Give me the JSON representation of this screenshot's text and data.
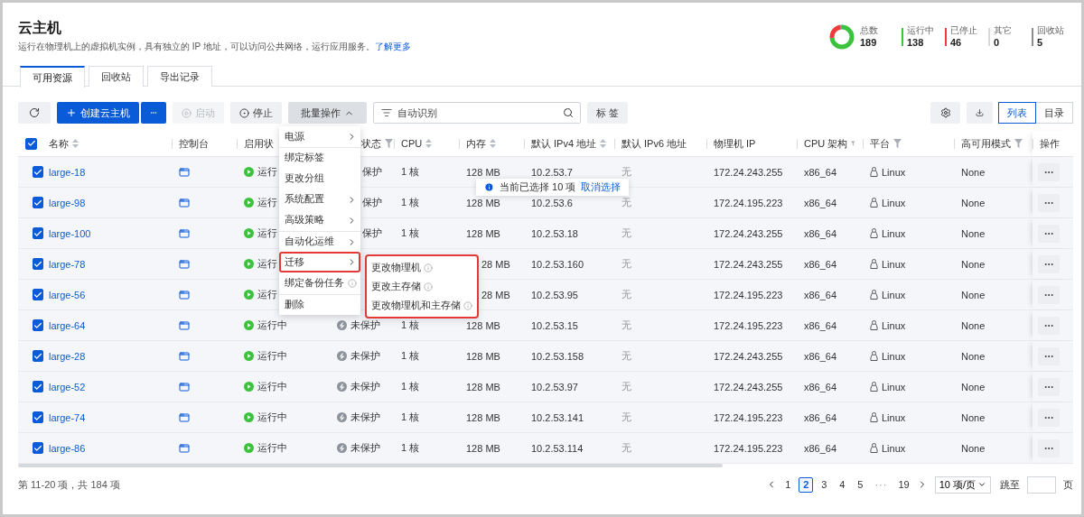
{
  "page": {
    "title": "云主机",
    "description": "运行在物理机上的虚拟机实例，具有独立的 IP 地址，可以访问公共网络，运行应用服务。",
    "learn_more": "了解更多"
  },
  "stats": [
    {
      "kind": "total",
      "label": "总数",
      "value": "189"
    },
    {
      "kind": "part",
      "label": "运行中",
      "value": "138",
      "color": "#3cc23c"
    },
    {
      "kind": "part",
      "label": "已停止",
      "value": "46",
      "color": "#ee3b3b"
    },
    {
      "kind": "part",
      "label": "其它",
      "value": "0",
      "color": "#d9d9d9"
    },
    {
      "kind": "part",
      "label": "回收站",
      "value": "5",
      "color": "#8c8c8c"
    }
  ],
  "tabs": [
    {
      "label": "可用资源",
      "selected": true
    },
    {
      "label": "回收站",
      "selected": false
    },
    {
      "label": "导出记录",
      "selected": false
    }
  ],
  "toolbar": {
    "create": "创建云主机",
    "start": {
      "label": "启动",
      "disabled": true
    },
    "stop": {
      "label": "停止",
      "disabled": false
    },
    "batch": {
      "label": "批量操作",
      "open": true
    },
    "search": {
      "placeholder": "自动识别"
    },
    "tags": "标 签",
    "views": [
      {
        "label": "列表",
        "selected": true
      },
      {
        "label": "目录",
        "selected": false
      }
    ]
  },
  "table": {
    "all_checked": true,
    "columns": [
      {
        "label": "名称",
        "kind": "sortable"
      },
      {
        "label": "控制台",
        "kind": "plain"
      },
      {
        "label": "启用状",
        "kind": "plain"
      },
      {
        "label": "状态",
        "kind": "filterable"
      },
      {
        "label": "CPU",
        "kind": "sortable"
      },
      {
        "label": "内存",
        "kind": "sortable"
      },
      {
        "label": "默认 IPv4 地址",
        "kind": "sortable"
      },
      {
        "label": "默认 IPv6 地址",
        "kind": "plain"
      },
      {
        "label": "物理机 IP",
        "kind": "plain"
      },
      {
        "label": "CPU 架构",
        "kind": "filterable"
      },
      {
        "label": "平台",
        "kind": "filterable"
      },
      {
        "label": "高可用模式",
        "kind": "filterable"
      },
      {
        "label": "操作",
        "kind": "plain"
      }
    ],
    "rows": [
      {
        "checked": true,
        "name": "large-18",
        "status": "运行",
        "protection": "保护",
        "cpu": "1 核",
        "memory": "128 MB",
        "ipv4": "10.2.53.7",
        "ipv6": "无",
        "host_ip": "172.24.243.255",
        "arch": "x86_64",
        "platform": "Linux",
        "ha": "None"
      },
      {
        "checked": true,
        "name": "large-98",
        "status": "运行",
        "protection": "保护",
        "cpu": "1 核",
        "memory": "128 MB",
        "ipv4": "10.2.53.6",
        "ipv6": "无",
        "host_ip": "172.24.195.223",
        "arch": "x86_64",
        "platform": "Linux",
        "ha": "None"
      },
      {
        "checked": true,
        "name": "large-100",
        "status": "运行",
        "protection": "保护",
        "cpu": "1 核",
        "memory": "128 MB",
        "ipv4": "10.2.53.18",
        "ipv6": "无",
        "host_ip": "172.24.243.255",
        "arch": "x86_64",
        "platform": "Linux",
        "ha": "None"
      },
      {
        "checked": true,
        "name": "large-78",
        "status": "运行",
        "memory": "28 MB",
        "ipv4": "10.2.53.160",
        "ipv6": "无",
        "host_ip": "172.24.243.255",
        "arch": "x86_64",
        "platform": "Linux",
        "ha": "None"
      },
      {
        "checked": true,
        "name": "large-56",
        "status": "运行",
        "memory": "28 MB",
        "ipv4": "10.2.53.95",
        "ipv6": "无",
        "host_ip": "172.24.195.223",
        "arch": "x86_64",
        "platform": "Linux",
        "ha": "None"
      },
      {
        "checked": true,
        "name": "large-64",
        "status": "运行中",
        "protection": "未保护",
        "cpu": "1 核",
        "memory": "128 MB",
        "ipv4": "10.2.53.15",
        "ipv6": "无",
        "host_ip": "172.24.195.223",
        "arch": "x86_64",
        "platform": "Linux",
        "ha": "None"
      },
      {
        "checked": true,
        "name": "large-28",
        "status": "运行中",
        "protection": "未保护",
        "cpu": "1 核",
        "memory": "128 MB",
        "ipv4": "10.2.53.158",
        "ipv6": "无",
        "host_ip": "172.24.243.255",
        "arch": "x86_64",
        "platform": "Linux",
        "ha": "None"
      },
      {
        "checked": true,
        "name": "large-52",
        "status": "运行中",
        "protection": "未保护",
        "cpu": "1 核",
        "memory": "128 MB",
        "ipv4": "10.2.53.97",
        "ipv6": "无",
        "host_ip": "172.24.243.255",
        "arch": "x86_64",
        "platform": "Linux",
        "ha": "None"
      },
      {
        "checked": true,
        "name": "large-74",
        "status": "运行中",
        "protection": "未保护",
        "cpu": "1 核",
        "memory": "128 MB",
        "ipv4": "10.2.53.141",
        "ipv6": "无",
        "host_ip": "172.24.195.223",
        "arch": "x86_64",
        "platform": "Linux",
        "ha": "None"
      },
      {
        "checked": true,
        "name": "large-86",
        "status": "运行中",
        "protection": "未保护",
        "cpu": "1 核",
        "memory": "128 MB",
        "ipv4": "10.2.53.114",
        "ipv6": "无",
        "host_ip": "172.24.195.223",
        "arch": "x86_64",
        "platform": "Linux",
        "ha": "None"
      }
    ],
    "selection_tip": {
      "text": "当前已选择 10 项",
      "action": "取消选择"
    }
  },
  "batch_menu": [
    {
      "label": "电源",
      "kind": "submenu",
      "divider": false,
      "highlighted": false
    },
    {
      "label": "绑定标签",
      "kind": "action",
      "divider": true,
      "highlighted": false
    },
    {
      "label": "更改分组",
      "kind": "action",
      "divider": false,
      "highlighted": false
    },
    {
      "label": "系统配置",
      "kind": "submenu",
      "divider": false,
      "highlighted": false
    },
    {
      "label": "高级策略",
      "kind": "submenu",
      "divider": false,
      "highlighted": false
    },
    {
      "label": "自动化运维",
      "kind": "submenu",
      "divider": true,
      "highlighted": false
    },
    {
      "label": "迁移",
      "kind": "submenu",
      "divider": false,
      "highlighted": true
    },
    {
      "label": "绑定备份任务",
      "kind": "info",
      "divider": false,
      "highlighted": false
    },
    {
      "label": "删除",
      "kind": "action",
      "divider": true,
      "highlighted": false
    }
  ],
  "migrate_menu": [
    {
      "label": "更改物理机",
      "kind": "info"
    },
    {
      "label": "更改主存储",
      "kind": "info"
    },
    {
      "label": "更改物理机和主存储",
      "kind": "info"
    }
  ],
  "pagination": {
    "summary": "第 11-20 项，共 184 项",
    "pages": [
      {
        "label": "1",
        "kind": "page",
        "selected": false
      },
      {
        "label": "2",
        "kind": "page",
        "selected": true
      },
      {
        "label": "3",
        "kind": "page",
        "selected": false
      },
      {
        "label": "4",
        "kind": "page",
        "selected": false
      },
      {
        "label": "5",
        "kind": "page",
        "selected": false
      },
      {
        "label": "···",
        "kind": "ellipsis",
        "selected": false
      },
      {
        "label": "19",
        "kind": "page",
        "selected": false
      }
    ],
    "page_size": "10 项/页",
    "jump_label": "跳至",
    "page_unit": "页"
  }
}
